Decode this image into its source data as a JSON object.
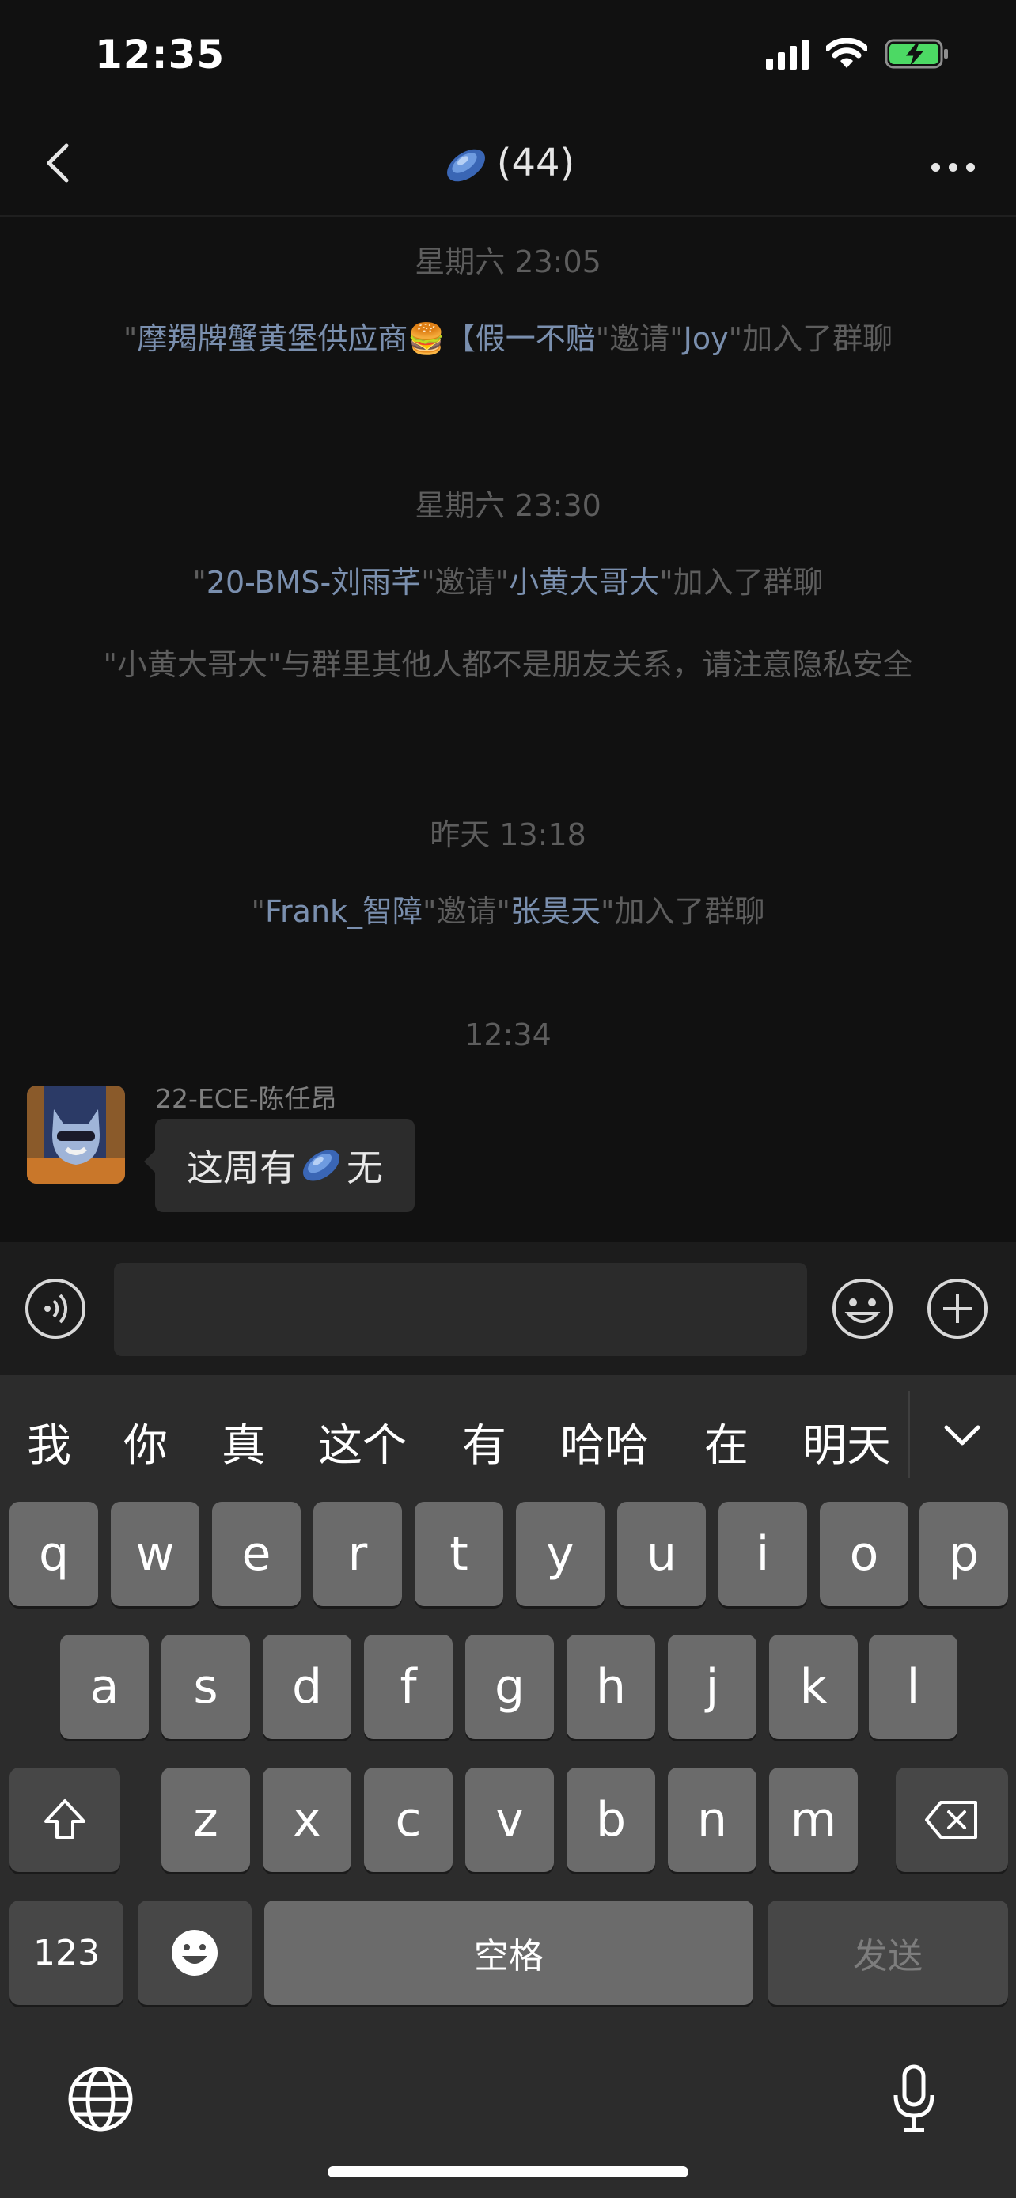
{
  "status_bar": {
    "time": "12:35"
  },
  "header": {
    "title": "(44)",
    "title_icon": "frisbee-disc-emoji"
  },
  "messages": [
    {
      "type": "timestamp",
      "text": "星期六 23:05"
    },
    {
      "type": "system",
      "parts": [
        "\"",
        "摩羯牌蟹黄堡供应商🍔【假一不赔",
        "\"邀请\"",
        "Joy",
        "\"加入了群聊"
      ]
    },
    {
      "type": "timestamp",
      "text": "星期六 23:30"
    },
    {
      "type": "system",
      "parts": [
        "\"",
        "20-BMS-刘雨芊",
        "\"邀请\"",
        "小黄大哥大",
        "\"加入了群聊"
      ]
    },
    {
      "type": "system",
      "text": "\"小黄大哥大\"与群里其他人都不是朋友关系，请注意隐私安全"
    },
    {
      "type": "timestamp",
      "text": "昨天 13:18"
    },
    {
      "type": "system",
      "parts": [
        "\"",
        "Frank_智障",
        "\"邀请\"",
        "张昊天",
        "\"加入了群聊"
      ]
    },
    {
      "type": "timestamp",
      "text": "12:34"
    },
    {
      "type": "chat",
      "sender": "22-ECE-陈任昂",
      "text_before": "这周有",
      "emoji": "frisbee-disc-emoji",
      "text_after": "无"
    }
  ],
  "input_bar": {
    "voice_icon": "voice-icon",
    "emoji_icon": "smiley-icon",
    "plus_icon": "plus-icon",
    "value": ""
  },
  "keyboard": {
    "candidates": [
      "我",
      "你",
      "真",
      "这个",
      "有",
      "哈哈",
      "在",
      "明天"
    ],
    "row1": [
      "q",
      "w",
      "e",
      "r",
      "t",
      "y",
      "u",
      "i",
      "o",
      "p"
    ],
    "row2": [
      "a",
      "s",
      "d",
      "f",
      "g",
      "h",
      "j",
      "k",
      "l"
    ],
    "row3": [
      "z",
      "x",
      "c",
      "v",
      "b",
      "n",
      "m"
    ],
    "numbers_label": "123",
    "space_label": "空格",
    "send_label": "发送"
  },
  "colors": {
    "background": "#111111",
    "system_highlight": "#7a8fae",
    "bubble": "#2c2c2c",
    "keyboard": "#2c2c2c",
    "key": "#6b6b6b"
  }
}
